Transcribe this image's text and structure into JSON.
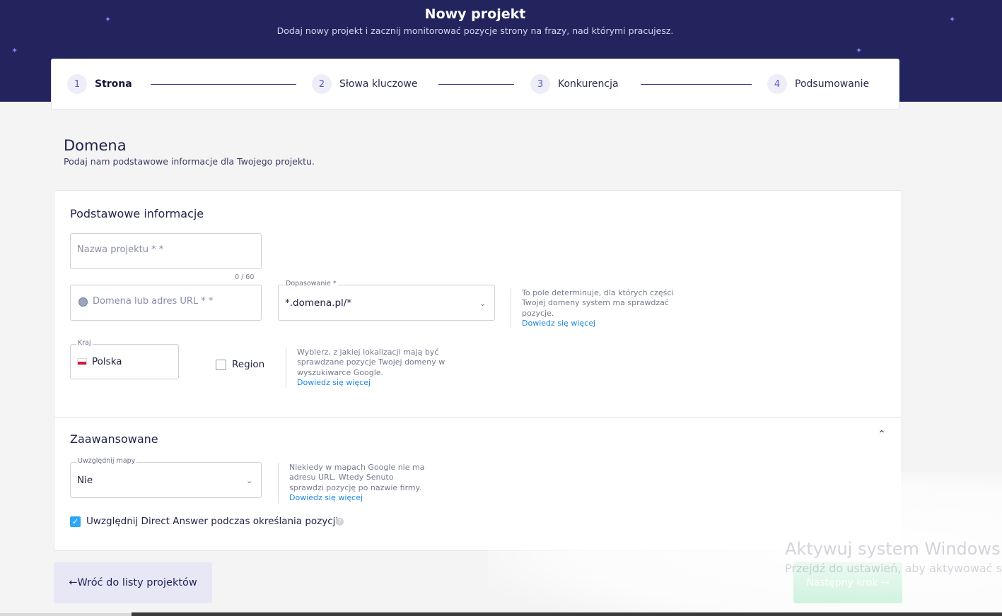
{
  "header": {
    "title": "Nowy projekt",
    "subtitle": "Dodaj nowy projekt i zacznij monitorować pozycje strony na frazy, nad którymi pracujesz."
  },
  "stepper": [
    {
      "num": "1",
      "label": "Strona",
      "active": true
    },
    {
      "num": "2",
      "label": "Słowa kluczowe",
      "active": false
    },
    {
      "num": "3",
      "label": "Konkurencja",
      "active": false
    },
    {
      "num": "4",
      "label": "Podsumowanie",
      "active": false
    }
  ],
  "section": {
    "title": "Domena",
    "subtitle": "Podaj nam podstawowe informacje dla Twojego projektu."
  },
  "basic": {
    "title": "Podstawowe informacje",
    "project_name_placeholder": "Nazwa projektu * *",
    "project_name_counter": "0 / 60",
    "domain_placeholder": "Domena lub adres URL * *",
    "match_label": "Dopasowanie *",
    "match_value": "*.domena.pl/*",
    "match_hint": "To pole determinuje, dla których części Twojej domeny system ma sprawdzać pozycje.",
    "learn_more": "Dowiedz się więcej",
    "country_label": "Kraj",
    "country_value": "Polska",
    "region_label": "Region",
    "region_checked": false,
    "location_hint": "Wybierz, z jakiej lokalizacji mają być sprawdzane pozycje Twojej domeny w wyszukiwarce Google."
  },
  "advanced": {
    "title": "Zaawansowane",
    "maps_label": "Uwzględnij mapy",
    "maps_value": "Nie",
    "maps_hint": "Niekiedy w mapach Google nie ma adresu URL. Wtedy Senuto sprawdzi pozycję po nazwie firmy.",
    "direct_answer_label": "Uwzględnij Direct Answer podczas określania pozycji",
    "direct_answer_checked": true
  },
  "footer": {
    "back_label": "Wróć do listy projektów",
    "next_label": "Następny krok"
  },
  "watermark": {
    "line1": "Aktywuj system Windows",
    "line2": "Przejdź do ustawień, aby aktywować system Windows."
  }
}
